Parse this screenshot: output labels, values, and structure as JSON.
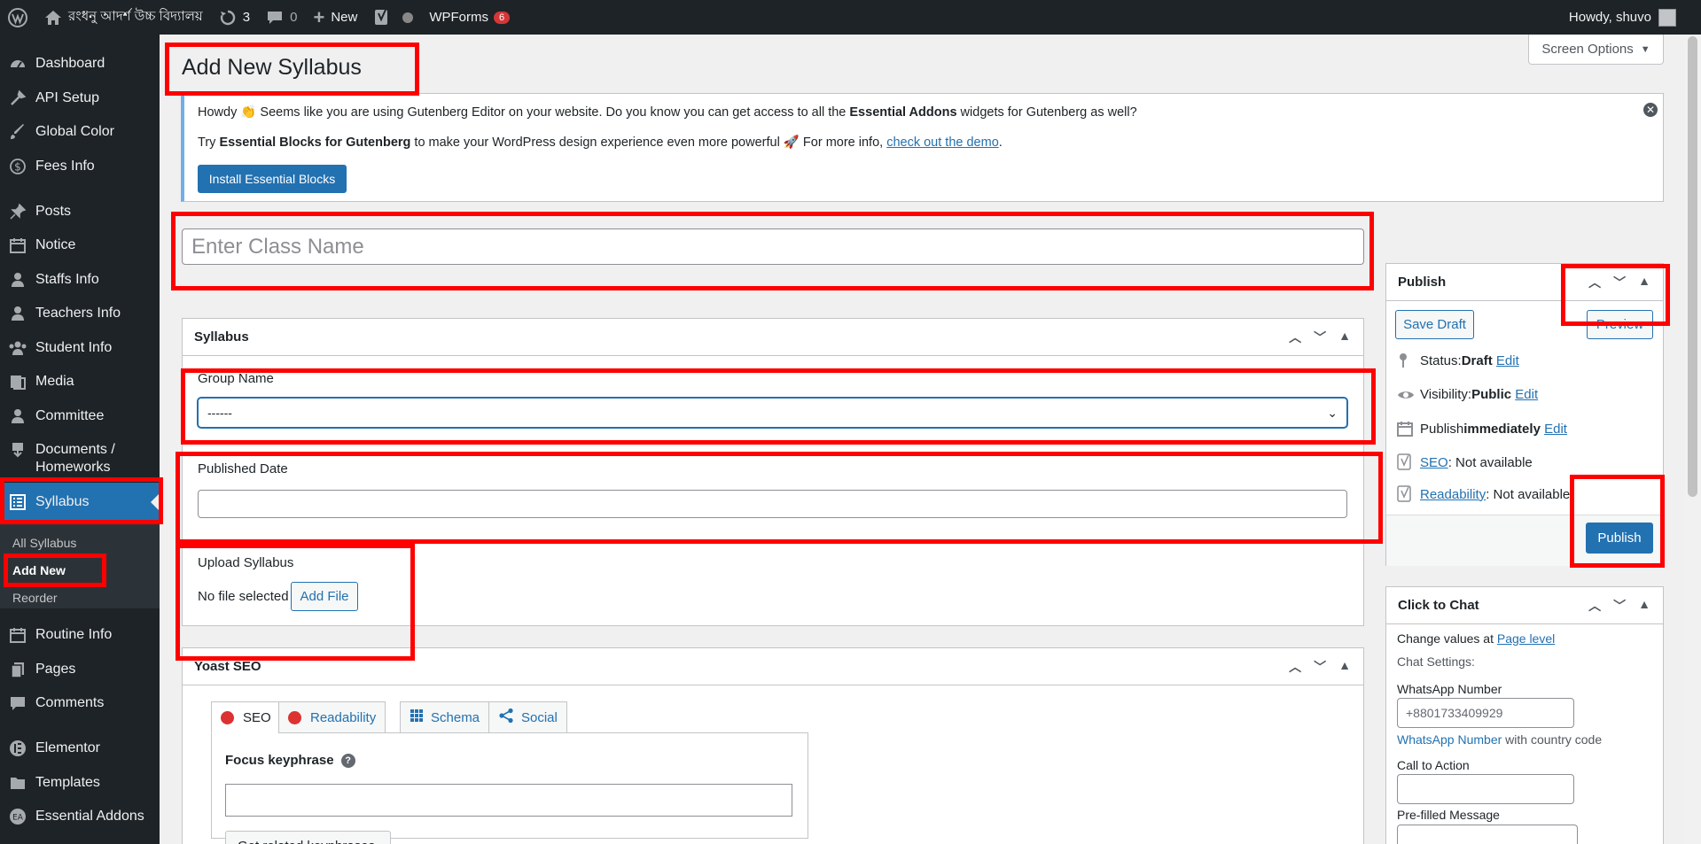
{
  "adminbar": {
    "site_name": "রংধনু আদর্শ উচ্চ বিদ্যালয়",
    "updates_count": "3",
    "comments_count": "0",
    "new_label": "New",
    "wpforms_label": "WPForms",
    "wpforms_badge": "6",
    "howdy": "Howdy, shuvo"
  },
  "sidebar": {
    "items": [
      {
        "label": "Dashboard",
        "icon": "dashboard-icon"
      },
      {
        "label": "API Setup",
        "icon": "tools-icon"
      },
      {
        "label": "Global Color",
        "icon": "brush-icon"
      },
      {
        "label": "Fees Info",
        "icon": "dollar-icon"
      },
      {
        "label": "Posts",
        "icon": "pin-icon"
      },
      {
        "label": "Notice",
        "icon": "calendar-icon"
      },
      {
        "label": "Staffs Info",
        "icon": "user-icon"
      },
      {
        "label": "Teachers Info",
        "icon": "user-icon"
      },
      {
        "label": "Student Info",
        "icon": "groups-icon"
      },
      {
        "label": "Media",
        "icon": "media-icon"
      },
      {
        "label": "Committee",
        "icon": "user-icon"
      },
      {
        "label": "Documents / Homeworks",
        "icon": "download-icon"
      },
      {
        "label": "Syllabus",
        "icon": "list-icon"
      },
      {
        "label": "Routine Info",
        "icon": "calendar-icon"
      },
      {
        "label": "Pages",
        "icon": "pages-icon"
      },
      {
        "label": "Comments",
        "icon": "comment-icon"
      },
      {
        "label": "Elementor",
        "icon": "elementor-icon"
      },
      {
        "label": "Templates",
        "icon": "folder-icon"
      },
      {
        "label": "Essential Addons",
        "icon": "ea-icon"
      }
    ],
    "documents_line1": "Documents /",
    "documents_line2": "Homeworks",
    "submenu": [
      "All Syllabus",
      "Add New",
      "Reorder"
    ]
  },
  "header": {
    "title": "Add New Syllabus",
    "screen_options": "Screen Options"
  },
  "notice": {
    "line1_prefix": "Howdy 👏 Seems like you are using Gutenberg Editor on your website. Do you know you can get access to all the ",
    "line1_bold": "Essential Addons",
    "line1_suffix": " widgets for Gutenberg as well?",
    "line2_try": "Try ",
    "line2_bold": "Essential Blocks for Gutenberg",
    "line2_mid": " to make your WordPress design experience even more powerful 🚀 For more info, ",
    "line2_link": "check out the demo",
    "line2_end": ".",
    "button": "Install Essential Blocks"
  },
  "title_field": {
    "placeholder": "Enter Class Name"
  },
  "syllabus_box": {
    "title": "Syllabus",
    "group_label": "Group Name",
    "group_value": "------",
    "published_label": "Published Date",
    "published_value": "",
    "upload_label": "Upload Syllabus",
    "no_file": "No file selected",
    "add_file": "Add File"
  },
  "yoast": {
    "title": "Yoast SEO",
    "tabs": [
      "SEO",
      "Readability",
      "Schema",
      "Social"
    ],
    "focus_label": "Focus keyphrase",
    "related_button": "Get related keyphrases"
  },
  "publish": {
    "title": "Publish",
    "save_draft": "Save Draft",
    "preview": "Preview",
    "status_label": "Status: ",
    "status_value": "Draft",
    "visibility_label": "Visibility: ",
    "visibility_value": "Public",
    "publish_label": "Publish ",
    "publish_value": "immediately",
    "edit": "Edit",
    "seo_link": "SEO",
    "seo_value": ": Not available",
    "readability_link": "Readability",
    "readability_value": ": Not available",
    "publish_button": "Publish"
  },
  "chat": {
    "title": "Click to Chat",
    "change_values": "Change values at ",
    "page_level": "Page level",
    "chat_settings": "Chat Settings:",
    "whatsapp_label": "WhatsApp Number",
    "whatsapp_placeholder": "+8801733409929",
    "whatsapp_link": "WhatsApp Number",
    "whatsapp_hint": " with country code",
    "cta_label": "Call to Action",
    "prefilled_label": "Pre-filled Message"
  },
  "colors": {
    "accent": "#2271b1",
    "adminbar": "#1d2327",
    "highlight": "#ff0000"
  }
}
